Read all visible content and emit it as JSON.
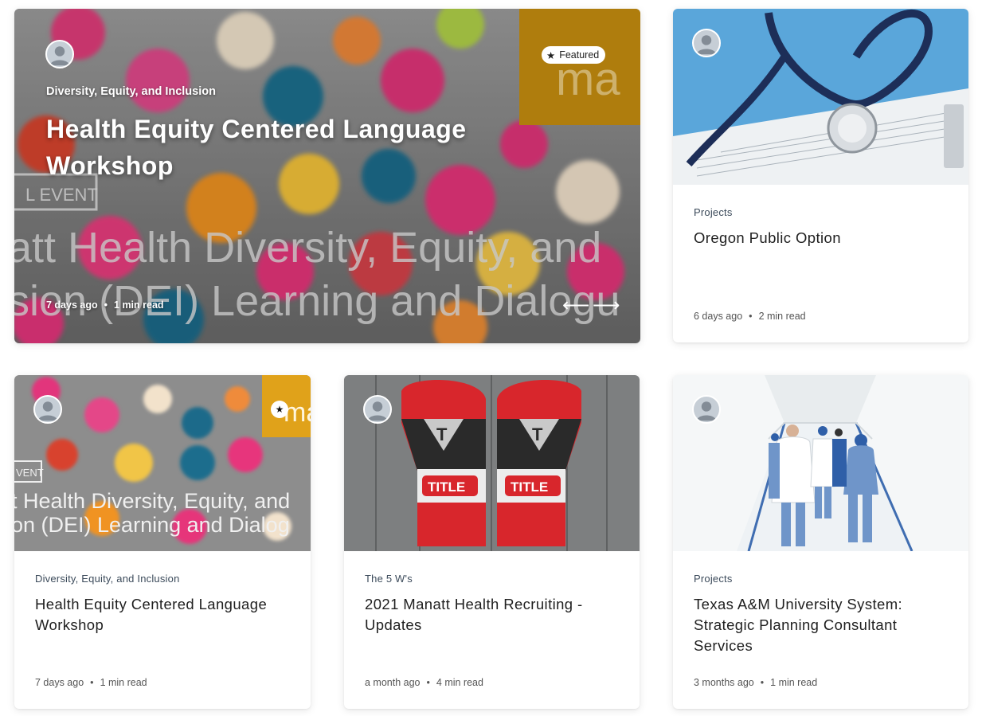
{
  "featured": {
    "category": "Diversity, Equity, and Inclusion",
    "title": "Health Equity Centered Language Workshop",
    "badge": "Featured",
    "date": "7 days ago",
    "read": "1 min read",
    "image_text": {
      "brand": "ma",
      "event": "L EVENT",
      "line1": "att Health Diversity, Equity, and",
      "line2": "sion (DEI) Learning and Dialogu"
    },
    "prev_arrow": "⟵",
    "next_arrow": "⟶"
  },
  "cards": [
    {
      "category": "Projects",
      "title": "Oregon Public Option",
      "date": "6 days ago",
      "read": "2 min read"
    },
    {
      "category": "Diversity, Equity, and Inclusion",
      "title": "Health Equity Centered Language Workshop",
      "date": "7 days ago",
      "read": "1 min read",
      "image_text": {
        "brand": "ma",
        "event": "VENT",
        "line1": "t Health Diversity, Equity, and",
        "line2": "on (DEI) Learning and Dialog"
      }
    },
    {
      "category": "The 5 W's",
      "title": "2021 Manatt Health Recruiting - Updates",
      "date": "a month ago",
      "read": "4 min read",
      "image_text": {
        "glove": "TITLE",
        "logo": "T"
      }
    },
    {
      "category": "Projects",
      "title": "Texas A&M University System: Strategic Planning Consultant Services",
      "date": "3 months ago",
      "read": "1 min read"
    }
  ],
  "separator": "•",
  "colors": {
    "brand_gold": "#e0a21a",
    "sky_blue": "#5aa6da",
    "glove_red": "#d8262c"
  }
}
